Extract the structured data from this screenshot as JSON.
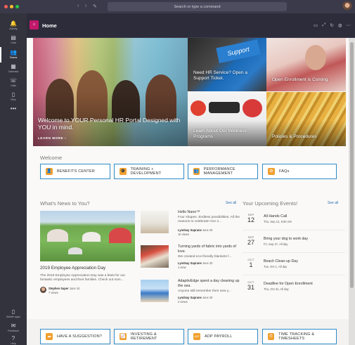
{
  "titlebar": {
    "search_placeholder": "Search or type a command",
    "back_glyph": "‹",
    "forward_glyph": "›",
    "compose_glyph": "✎"
  },
  "rail": {
    "items": [
      {
        "label": "Activity",
        "icon": "bell-icon",
        "glyph": "🔔"
      },
      {
        "label": "Chat",
        "icon": "chat-icon",
        "glyph": "▤"
      },
      {
        "label": "Teams",
        "icon": "teams-icon",
        "glyph": "👥"
      },
      {
        "label": "Calendar",
        "icon": "calendar-icon",
        "glyph": "▦"
      },
      {
        "label": "Calls",
        "icon": "phone-icon",
        "glyph": "☏"
      },
      {
        "label": "Files",
        "icon": "file-icon",
        "glyph": "▯"
      },
      {
        "label": "...",
        "icon": "more-icon",
        "glyph": "•••"
      }
    ],
    "bottom_items": [
      {
        "label": "Mobile apps",
        "icon": "mobile-icon",
        "glyph": "▯"
      },
      {
        "label": "Feedback",
        "icon": "feedback-icon",
        "glyph": "✉"
      },
      {
        "label": "Help",
        "icon": "help-icon",
        "glyph": "?"
      }
    ]
  },
  "header": {
    "title": "Home",
    "home_glyph": "⌂",
    "actions": [
      {
        "name": "chat-icon",
        "glyph": "▭"
      },
      {
        "name": "expand-icon",
        "glyph": "⤢"
      },
      {
        "name": "refresh-icon",
        "glyph": "↻"
      },
      {
        "name": "globe-icon",
        "glyph": "◍"
      },
      {
        "name": "more-icon",
        "glyph": "⋯"
      }
    ]
  },
  "hero": {
    "main_title": "Welcome to YOUR Personal HR Portal Designed with YOU in mind.",
    "learn_more": "LEARN MORE ›",
    "tiles": [
      {
        "label": "Need HR Service? Open a Support Ticket."
      },
      {
        "label": "Open Enrollment is Coming"
      },
      {
        "label": "Learn About Our Wellness Programs"
      },
      {
        "label": "Policies & Procedures"
      }
    ]
  },
  "welcome": {
    "title": "Welcome",
    "buttons": [
      {
        "label": "BENEFITS CENTER",
        "icon": "person-icon",
        "glyph": "👤",
        "color": "#f0a030"
      },
      {
        "label": "TRAINING + DEVELOPMENT",
        "icon": "training-icon",
        "glyph": "🎓",
        "color": "#f0a030"
      },
      {
        "label": "PERFORMANCE MANAGEMENT",
        "icon": "people-icon",
        "glyph": "👥",
        "color": "#f0a030"
      },
      {
        "label": "FAQs",
        "icon": "gear-icon",
        "glyph": "⚙",
        "color": "#f0a030"
      }
    ]
  },
  "news": {
    "title": "What's News to You?",
    "see_all": "See all",
    "featured": {
      "headline": "2019 Employee Appreciation Day",
      "desc": "The 2019 Employee Appreciation Day was a blast for our fantastic employees and their families. Check out som...",
      "author": "Stephen Saper",
      "date": "June 24",
      "views": "7 views"
    },
    "items": [
      {
        "title": "Hello Nano™",
        "desc": "Four shapes. Endless possibilities. All the reasons to celebrate! Our n...",
        "author": "Lyndsay Saprane",
        "date": "June 20",
        "views": "10 views"
      },
      {
        "title": "Turning yards of fabric into yards of love.",
        "desc": "We created eco-friendly blankets f...",
        "author": "Lyndsay Saprane",
        "date": "June 20",
        "views": "1 view"
      },
      {
        "title": "AdaptivEdge spent a day cleaning up the sea.",
        "desc": "Anyone still remember their new y...",
        "author": "Lyndsay Saprane",
        "date": "June 20",
        "views": "2 views"
      }
    ]
  },
  "events": {
    "title": "Your Upcoming Events!",
    "see_all": "See all",
    "items": [
      {
        "month": "SEP",
        "day": "12",
        "title": "All Hands Call",
        "sub": "Thu, Sep 12, 9:00 AM"
      },
      {
        "month": "SEP",
        "day": "27",
        "title": "Bring your dog to work day",
        "sub": "Fri, Sep 27, All day"
      },
      {
        "month": "OCT",
        "day": "1",
        "title": "Beach Clean-up Day",
        "sub": "Tue, Oct 1, All day"
      },
      {
        "month": "OCT",
        "day": "31",
        "title": "Deadline for Open Enrollment",
        "sub": "Thu, Oct 31, All day"
      }
    ]
  },
  "quick_links": {
    "buttons": [
      {
        "label": "HAVE A SUGGESTION?",
        "icon": "suggestion-icon",
        "glyph": "☁",
        "color": "#f0a030"
      },
      {
        "label": "INVESTING & RETIREMENT",
        "icon": "chart-icon",
        "glyph": "📈",
        "color": "#f0a030"
      },
      {
        "label": "ADP PAYROLL",
        "icon": "payroll-icon",
        "glyph": "ADP",
        "color": "#f0a030"
      },
      {
        "label": "TIME TRACKING & TIMESHEETS",
        "icon": "clock-icon",
        "glyph": "⏱",
        "color": "#f0a030"
      }
    ]
  },
  "colors": {
    "accent": "#2f8bc7",
    "brand_pink": "#c2186b",
    "icon_orange": "#f0a030",
    "rail": "#33333d",
    "header": "#2d2c3b"
  }
}
